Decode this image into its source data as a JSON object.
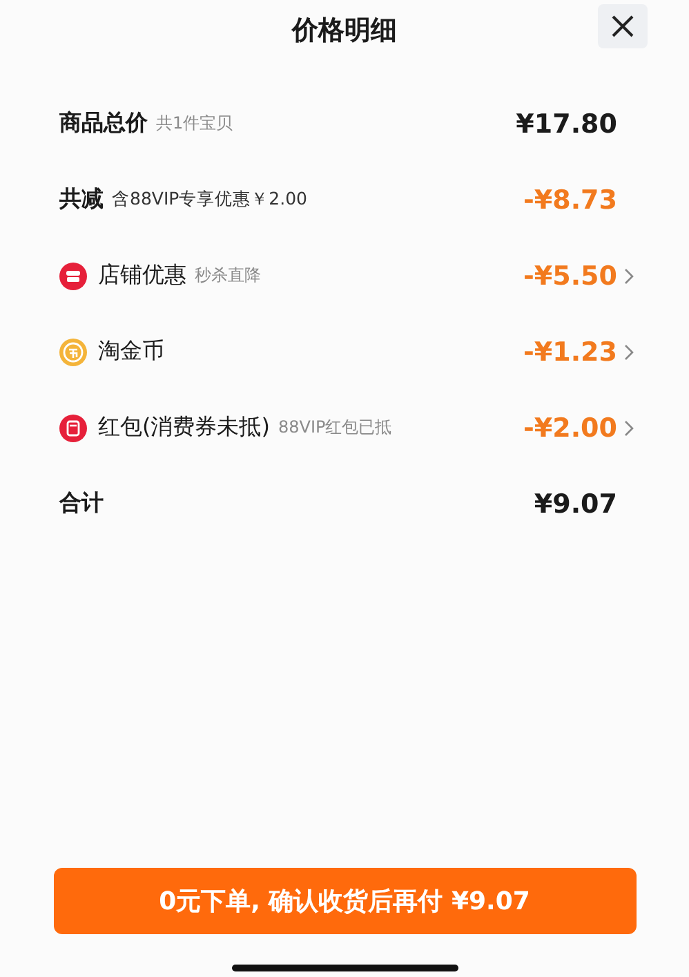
{
  "title": "价格明细",
  "rows": [
    {
      "kind": "summary",
      "label": "商品总价",
      "note": "共1件宝贝",
      "amount": "¥17.80"
    },
    {
      "kind": "reduction",
      "label": "共减",
      "note": "含88VIP专享优惠￥2.00",
      "amount": "-¥8.73"
    },
    {
      "kind": "store",
      "label": "店铺优惠",
      "note": "秒杀直降",
      "amount": "-¥5.50"
    },
    {
      "kind": "coins",
      "label": "淘金币",
      "amount": "-¥1.23"
    },
    {
      "kind": "packet",
      "label": "红包(消费券未抵)",
      "note": "88VIP红包已抵",
      "amount": "-¥2.00"
    },
    {
      "kind": "summary",
      "label": "合计",
      "amount": "¥9.07"
    }
  ],
  "pay_button": "0元下单, 确认收货后再付 ¥9.07"
}
